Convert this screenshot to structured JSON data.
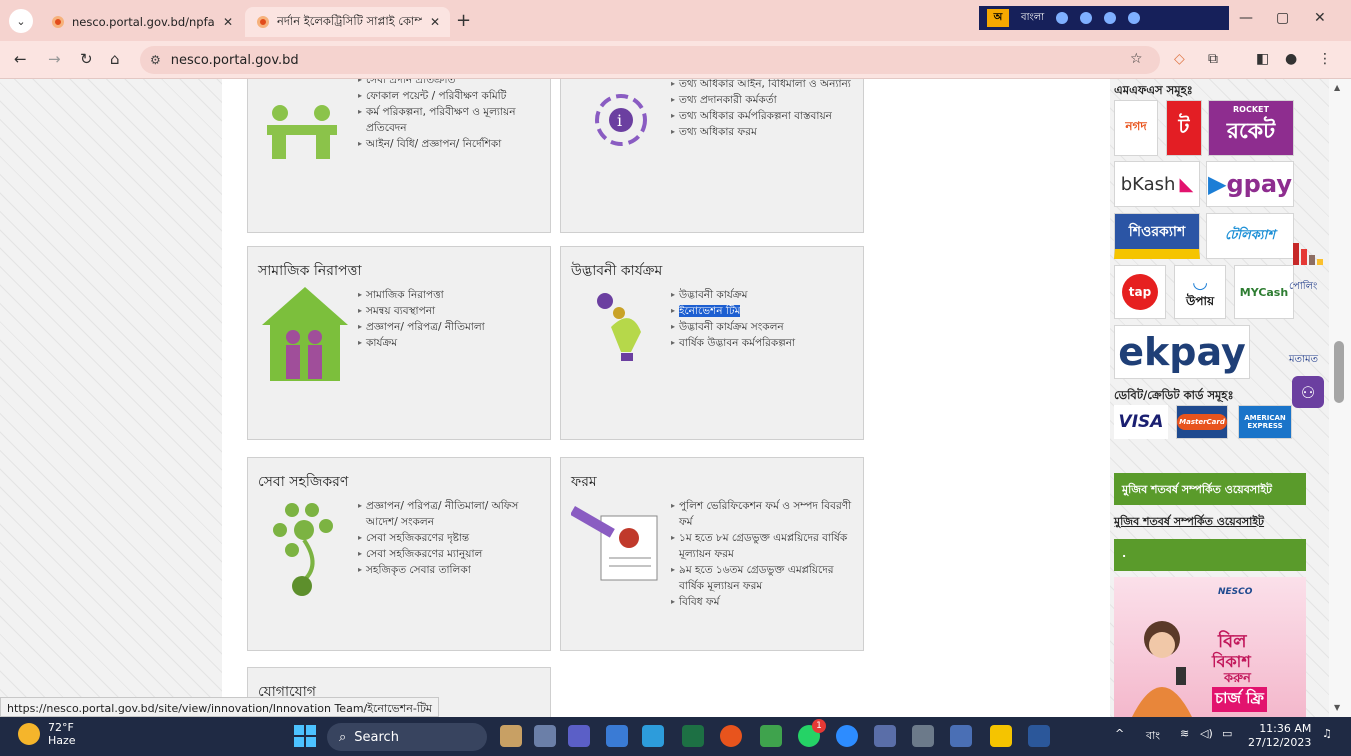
{
  "browser": {
    "tabs": [
      {
        "title": "nesco.portal.gov.bd/npfadmin/"
      },
      {
        "title": "নর্দান ইলেকট্রিসিটি সাপ্লাই কোম্পা"
      }
    ],
    "url": "nesco.portal.gov.bd",
    "ime_label": "বাংলা",
    "status_url": "https://nesco.portal.gov.bd/site/view/innovation/Innovation Team/ইনোভেশন-টিম"
  },
  "cards": {
    "c1": {
      "title": "",
      "items": [
        "সেবা প্রদান প্রতিশ্রুতি",
        "ফোকাল পয়েন্ট / পরিবীক্ষণ কমিটি",
        "কর্ম পরিকল্পনা, পরিবীক্ষণ ও মূল্যায়ন প্রতিবেদন",
        "আইন/ বিধি/ প্রজ্ঞাপন/ নির্দেশিকা"
      ]
    },
    "c2": {
      "title": "",
      "items": [
        "তথ্য অধিকার আইন, বিধিমালা ও অন্যান্য",
        "তথ্য প্রদানকারী কর্মকর্তা",
        "তথ্য অধিকার কর্মপরিকল্পনা বাস্তবায়ন",
        "তথ্য অধিকার ফরম"
      ]
    },
    "c3": {
      "title": "সামাজিক নিরাপত্তা",
      "items": [
        "সামাজিক নিরাপত্তা",
        "সমন্বয় ব্যবস্থাপনা",
        "প্রজ্ঞাপন/ পরিপত্র/ নীতিমালা",
        "কার্যক্রম"
      ]
    },
    "c4": {
      "title": "উদ্ভাবনী কার্যক্রম",
      "items": [
        "উদ্ভাবনী কার্যক্রম",
        "ইনোভেশন টিম",
        "উদ্ভাবনী কার্যক্রম সংকলন",
        "বার্ষিক উদ্ভাবন কর্মপরিকল্পনা"
      ]
    },
    "c5": {
      "title": "সেবা সহজিকরণ",
      "items": [
        "প্রজ্ঞাপন/ পরিপত্র/ নীতিমালা/ অফিস আদেশ/ সংকলন",
        "সেবা সহজিকরণের দৃষ্টান্ত",
        "সেবা সহজিকরণের ম্যানুয়াল",
        "সহজিকৃত সেবার তালিকা"
      ]
    },
    "c6": {
      "title": "ফরম",
      "items": [
        "পুলিশ ভেরিফিকেশন ফর্ম ও সম্পদ বিবরণী ফর্ম",
        "১ম হতে ৮ম গ্রেডভুক্ত এমপ্লয়িদের বার্ষিক মূল্যায়ন ফরম",
        "৯ম হতে ১৬তম গ্রেডভুক্ত এমপ্লয়িদের বার্ষিক মূল্যায়ন ফরম",
        "বিবিধ ফর্ম"
      ]
    },
    "c7": {
      "title": "যোগাযোগ"
    }
  },
  "sidebar": {
    "mfs_heading": "এমএফএস সমূহঃ",
    "logos": [
      "নগদ",
      "ট",
      "রকেট",
      "bKash",
      "gpay",
      "শিওরক্যাশ",
      "টেলিক্যাশ",
      "tap",
      "উপায়",
      "MYCash",
      "ekpay"
    ],
    "rocket_small": "ROCKET",
    "card_heading": "ডেবিট/ক্রেডিট কার্ড সমূহঃ",
    "cards": [
      "VISA",
      "MasterCard",
      "AMERICAN EXPRESS"
    ],
    "mujib_bar": "মুজিব শতবর্ষ সম্পর্কিত ওয়েবসাইট",
    "mujib_link": "মুজিব শতবর্ষ সম্পর্কিত ওয়েবসাইট",
    "dot_bar": ".",
    "banner": {
      "brand": "NESCO",
      "text1": "বিল",
      "text2": "বিকাশ",
      "text3": "করুন",
      "text4": "চার্জ ফ্রি"
    }
  },
  "floating": {
    "poll": "পোলিং",
    "opinion": "মতামত"
  },
  "taskbar": {
    "temp": "72°F",
    "weather": "Haze",
    "search": "Search",
    "lang": "বাং",
    "time": "11:36 AM",
    "date": "27/12/2023",
    "badge": "1"
  }
}
